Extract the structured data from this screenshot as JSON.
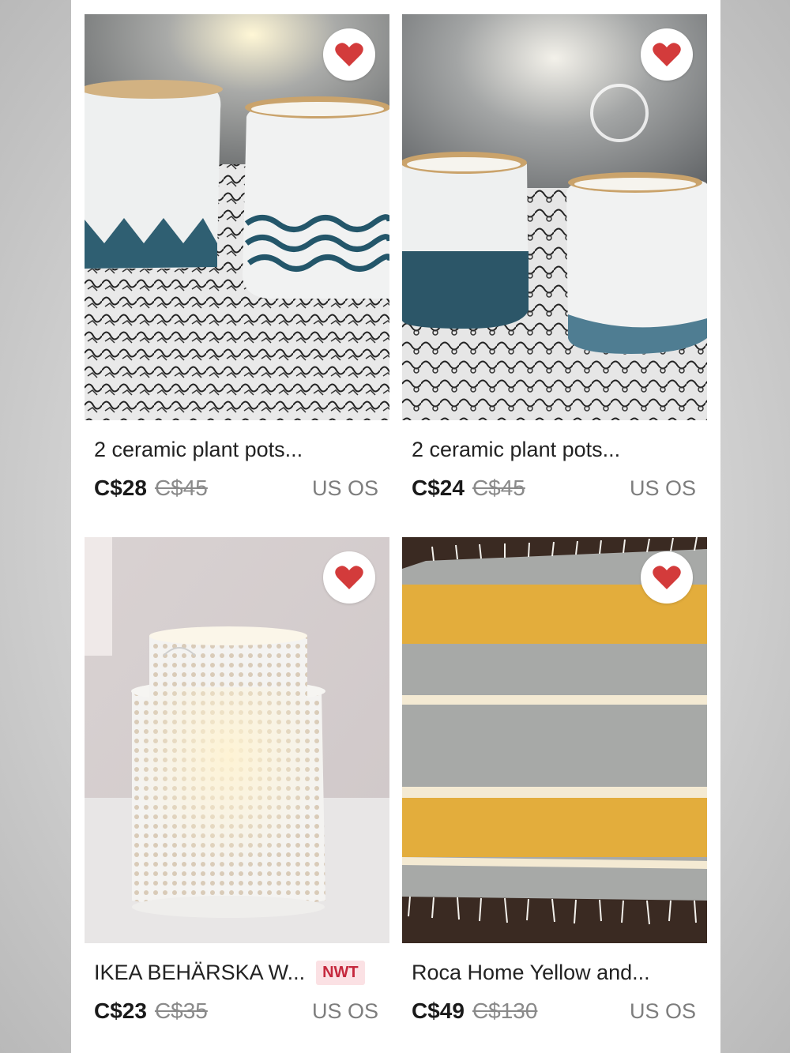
{
  "colors": {
    "heart": "#d33b3b",
    "badge_bg": "#fbe1e4",
    "badge_text": "#c5283d"
  },
  "listings": [
    {
      "title": "2 ceramic plant pots...",
      "price": "C$28",
      "original_price": "C$45",
      "size": "US OS",
      "liked": true,
      "photo": "two-white-ceramic-pots-with-blue-pattern"
    },
    {
      "title": "2 ceramic plant pots...",
      "price": "C$24",
      "original_price": "C$45",
      "size": "US OS",
      "liked": true,
      "photo": "two-white-ceramic-pots-blue-base"
    },
    {
      "title": "IKEA BEHÄRSKA W...",
      "badge": "NWT",
      "price": "C$23",
      "original_price": "C$35",
      "size": "US OS",
      "liked": true,
      "photo": "white-perforated-lantern"
    },
    {
      "title": "Roca Home Yellow and...",
      "price": "C$49",
      "original_price": "C$130",
      "size": "US OS",
      "liked": true,
      "photo": "yellow-grey-striped-throw"
    }
  ]
}
